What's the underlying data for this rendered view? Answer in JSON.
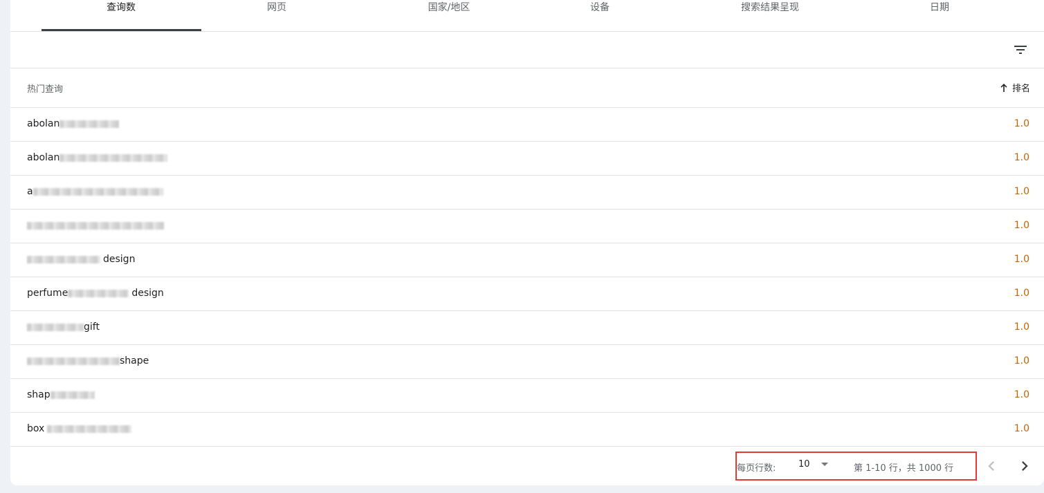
{
  "tabs": [
    {
      "label": "查询数"
    },
    {
      "label": "网页"
    },
    {
      "label": "国家/地区"
    },
    {
      "label": "设备"
    },
    {
      "label": "搜索结果呈现"
    },
    {
      "label": "日期"
    }
  ],
  "table": {
    "query_header": "热门查询",
    "rank_header": "排名",
    "rows": [
      {
        "prefix": "abolan",
        "suffix": "",
        "rank": "1.0"
      },
      {
        "prefix": "abolan",
        "suffix": "",
        "rank": "1.0"
      },
      {
        "prefix": "a",
        "suffix": "",
        "rank": "1.0"
      },
      {
        "prefix": "",
        "suffix": "",
        "rank": "1.0"
      },
      {
        "prefix": "",
        "suffix": "design",
        "rank": "1.0"
      },
      {
        "prefix": "perfume",
        "suffix": "design",
        "rank": "1.0"
      },
      {
        "prefix": "",
        "suffix": "gift",
        "rank": "1.0"
      },
      {
        "prefix": "",
        "suffix": "shape",
        "rank": "1.0"
      },
      {
        "prefix": "shap",
        "suffix": "",
        "rank": "1.0"
      },
      {
        "prefix": "box",
        "suffix": "",
        "rank": "1.0"
      }
    ]
  },
  "pagination": {
    "rows_per_page_label": "每页行数:",
    "rows_per_page_value": "10",
    "range_text": "第 1-10 行，共 1000 行"
  },
  "colors": {
    "accent_rank": "#c26401",
    "highlight_border": "#e53935"
  }
}
